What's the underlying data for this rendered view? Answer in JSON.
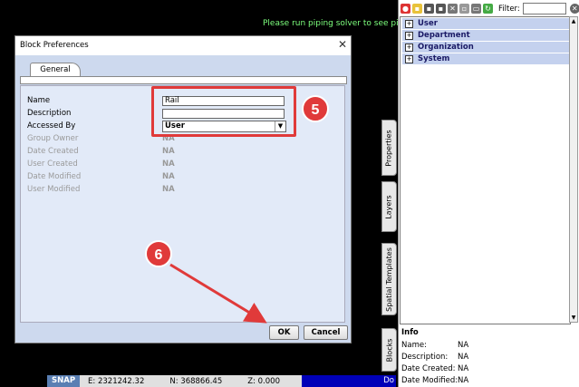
{
  "canvas": {
    "hint": "Please run piping solver to see pipes"
  },
  "statusbar": {
    "snap": "SNAP",
    "easting": "E: 2321242.32",
    "northing": "N: 368866.45",
    "z": "Z: 0.000",
    "right_text": "Do"
  },
  "side_tabs": [
    "Properties",
    "Layers",
    "Spatial Templates",
    "Blocks"
  ],
  "right_panel": {
    "filter_label": "Filter:",
    "filter_value": "",
    "tree": [
      "User",
      "Department",
      "Organization",
      "System"
    ],
    "info": {
      "title": "Info",
      "rows": [
        {
          "label": "Name:",
          "value": "NA"
        },
        {
          "label": "Description:",
          "value": "NA"
        },
        {
          "label": "Date Created:",
          "value": "NA"
        },
        {
          "label": "Date Modified:",
          "value": "NA"
        }
      ]
    }
  },
  "dialog": {
    "title": "Block Preferences",
    "tab": "General",
    "fields": {
      "name_label": "Name",
      "name_value": "Rail",
      "description_label": "Description",
      "description_value": "",
      "accessed_by_label": "Accessed By",
      "accessed_by_value": "User"
    },
    "readonly": [
      {
        "label": "Group Owner",
        "value": "NA"
      },
      {
        "label": "Date Created",
        "value": "NA"
      },
      {
        "label": "User Created",
        "value": "NA"
      },
      {
        "label": "Date Modified",
        "value": "NA"
      },
      {
        "label": "User Modified",
        "value": "NA"
      }
    ],
    "ok_label": "OK",
    "cancel_label": "Cancel"
  },
  "annotations": {
    "step_a": "5",
    "step_b": "6",
    "color": "#e03a3a"
  }
}
